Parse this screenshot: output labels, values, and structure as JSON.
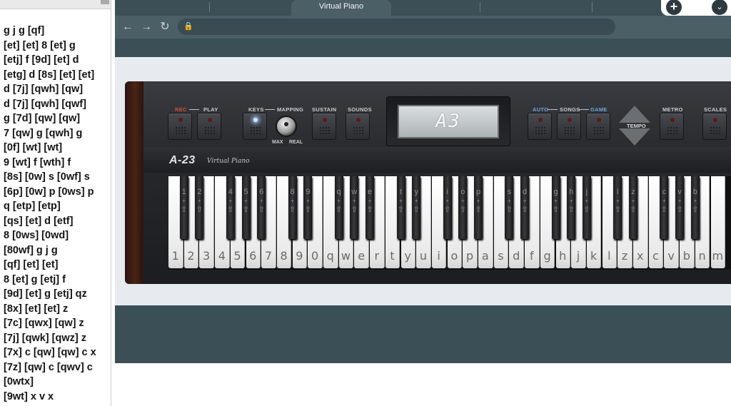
{
  "notes": {
    "lines": [
      "g j g [qf]",
      "[et] [et] 8 [et] g",
      "[etj] f [9d] [et] d",
      "[etg] d [8s] [et] [et]",
      "d [7j] [qwh] [qw]",
      "d [7j] [qwh] [qwf]",
      "g [7d] [qw] [qw]",
      "7 [qw] g [qwh] g",
      "[0f] [wt] [wt]",
      "9 [wt] f [wth] f",
      "[8s] [0w] s [0wf] s",
      "[6p] [0w] p [0ws] p",
      "q [etp] [etp]",
      "[qs] [et] d [etf]",
      "8 [0ws] [0wd]",
      "[80wf] g j g",
      "[qf] [et] [et]",
      "8 [et] g [etj] f",
      "[9d] [et] g [etj] qz",
      "[8x] [et] [et] z",
      "[7c] [qwx] [qw] z",
      "[7j] [qwk] [qwz] z",
      "[7x] c [qw] [qw] c x",
      "[7z] [qw] c [qwv] c",
      "[0wtx]",
      "[9wt] x v x"
    ]
  },
  "browser": {
    "active_tab_title": "Virtual Piano",
    "new_tab_symbol": "+",
    "tab_menu_symbol": "⌄",
    "back_symbol": "←",
    "forward_symbol": "→",
    "reload_symbol": "↻",
    "lock_symbol": "🔒",
    "address": ""
  },
  "piano": {
    "display": "A3",
    "brand": "A-23",
    "brand_sub": "Virtual Piano",
    "labels": {
      "rec": "REC",
      "play": "PLAY",
      "keys": "KEYS",
      "mapping": "MAPPING",
      "sustain": "SUSTAIN",
      "sounds": "SOUNDS",
      "auto": "AUTO",
      "songs": "SONGS",
      "game": "GAME",
      "metro": "METRO",
      "scales": "SCALES",
      "tempo": "TEMPO",
      "max": "MAX",
      "real": "REAL"
    },
    "white_keys": [
      "1",
      "2",
      "3",
      "4",
      "5",
      "6",
      "7",
      "8",
      "9",
      "0",
      "q",
      "w",
      "e",
      "r",
      "t",
      "y",
      "u",
      "i",
      "o",
      "p",
      "a",
      "s",
      "d",
      "f",
      "g",
      "h",
      "j",
      "k",
      "l",
      "z",
      "x",
      "c",
      "v",
      "b",
      "n",
      "m"
    ],
    "black_keys": [
      {
        "label": "1",
        "after": 0
      },
      {
        "label": "2",
        "after": 1
      },
      {
        "label": "4",
        "after": 3
      },
      {
        "label": "5",
        "after": 4
      },
      {
        "label": "6",
        "after": 5
      },
      {
        "label": "8",
        "after": 7
      },
      {
        "label": "9",
        "after": 8
      },
      {
        "label": "q",
        "after": 10
      },
      {
        "label": "w",
        "after": 11
      },
      {
        "label": "e",
        "after": 12
      },
      {
        "label": "t",
        "after": 14
      },
      {
        "label": "y",
        "after": 15
      },
      {
        "label": "i",
        "after": 17
      },
      {
        "label": "o",
        "after": 18
      },
      {
        "label": "p",
        "after": 19
      },
      {
        "label": "s",
        "after": 21
      },
      {
        "label": "d",
        "after": 22
      },
      {
        "label": "g",
        "after": 24
      },
      {
        "label": "h",
        "after": 25
      },
      {
        "label": "j",
        "after": 26
      },
      {
        "label": "l",
        "after": 28
      },
      {
        "label": "z",
        "after": 29
      },
      {
        "label": "c",
        "after": 31
      },
      {
        "label": "v",
        "after": 32
      },
      {
        "label": "b",
        "after": 33
      }
    ],
    "black_plus": "+",
    "black_shift": "⇧",
    "colors": {
      "rec_label": "#d94a3c",
      "mode_label": "#6fa5d8",
      "led_on": "#cfe6ff"
    }
  }
}
